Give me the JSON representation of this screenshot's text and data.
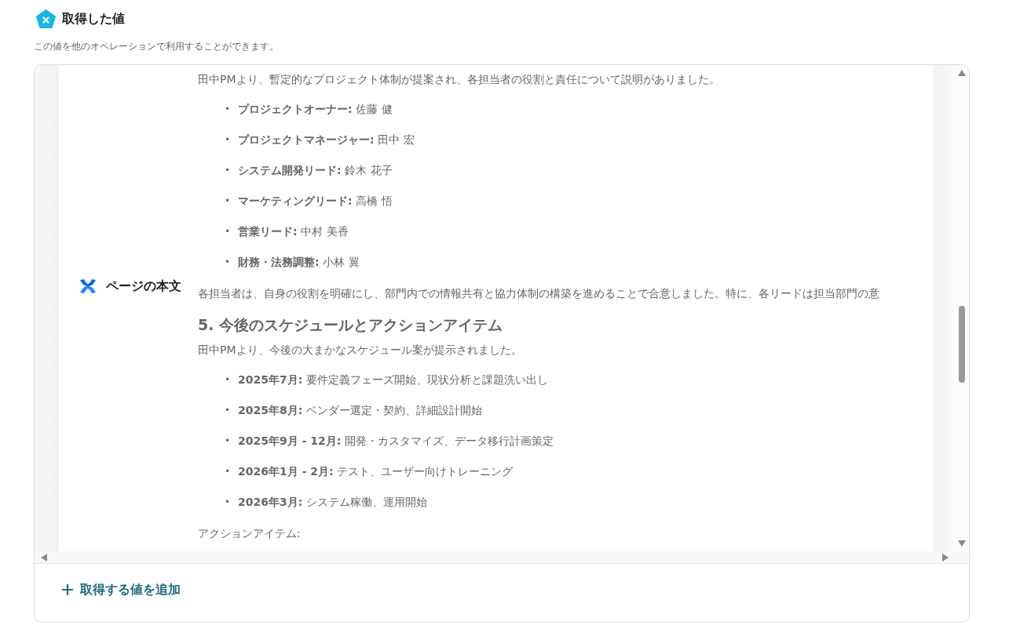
{
  "header": {
    "title": "取得した値",
    "description": "この値を他のオペレーションで利用することができます。"
  },
  "field": {
    "label": "ページの本文",
    "content": [
      {
        "kind": "paragraph",
        "text": "田中PMより、暫定的なプロジェクト体制が提案され、各担当者の役割と責任について説明がありました。"
      },
      {
        "kind": "list",
        "items": [
          {
            "bullet": "•",
            "text": "**プロジェクトオーナー:** 佐藤 健"
          },
          {
            "bullet": "•",
            "text": "**プロジェクトマネージャー:** 田中 宏"
          },
          {
            "bullet": "•",
            "text": "**システム開発リード:** 鈴木 花子"
          },
          {
            "bullet": "•",
            "text": "**マーケティングリード:** 高橋 悟"
          },
          {
            "bullet": "•",
            "text": "**営業リード:** 中村 美香"
          },
          {
            "bullet": "•",
            "text": "**財務・法務調整:** 小林 翼"
          }
        ]
      },
      {
        "kind": "paragraph",
        "text": "各担当者は、自身の役割を明確にし、部門内での情報共有と協力体制の構築を進めることで合意しました。特に、各リードは担当部門の意"
      },
      {
        "kind": "heading",
        "text": "5. 今後のスケジュールとアクションアイテム"
      },
      {
        "kind": "paragraph",
        "text": "田中PMより、今後の大まかなスケジュール案が提示されました。"
      },
      {
        "kind": "list",
        "items": [
          {
            "bullet": "•",
            "text": "**2025年7月:** 要件定義フェーズ開始、現状分析と課題洗い出し"
          },
          {
            "bullet": "•",
            "text": "**2025年8月:** ベンダー選定・契約、詳細設計開始"
          },
          {
            "bullet": "•",
            "text": "**2025年9月 - 12月:** 開発・カスタマイズ、データ移行計画策定"
          },
          {
            "bullet": "•",
            "text": "**2026年1月 - 2月:** テスト、ユーザー向けトレーニング"
          },
          {
            "bullet": "•",
            "text": "**2026年3月:** システム稼働、運用開始"
          }
        ]
      },
      {
        "kind": "paragraph",
        "text": "アクションアイテム:"
      }
    ]
  },
  "add_button": {
    "label": "取得する値を追加"
  }
}
